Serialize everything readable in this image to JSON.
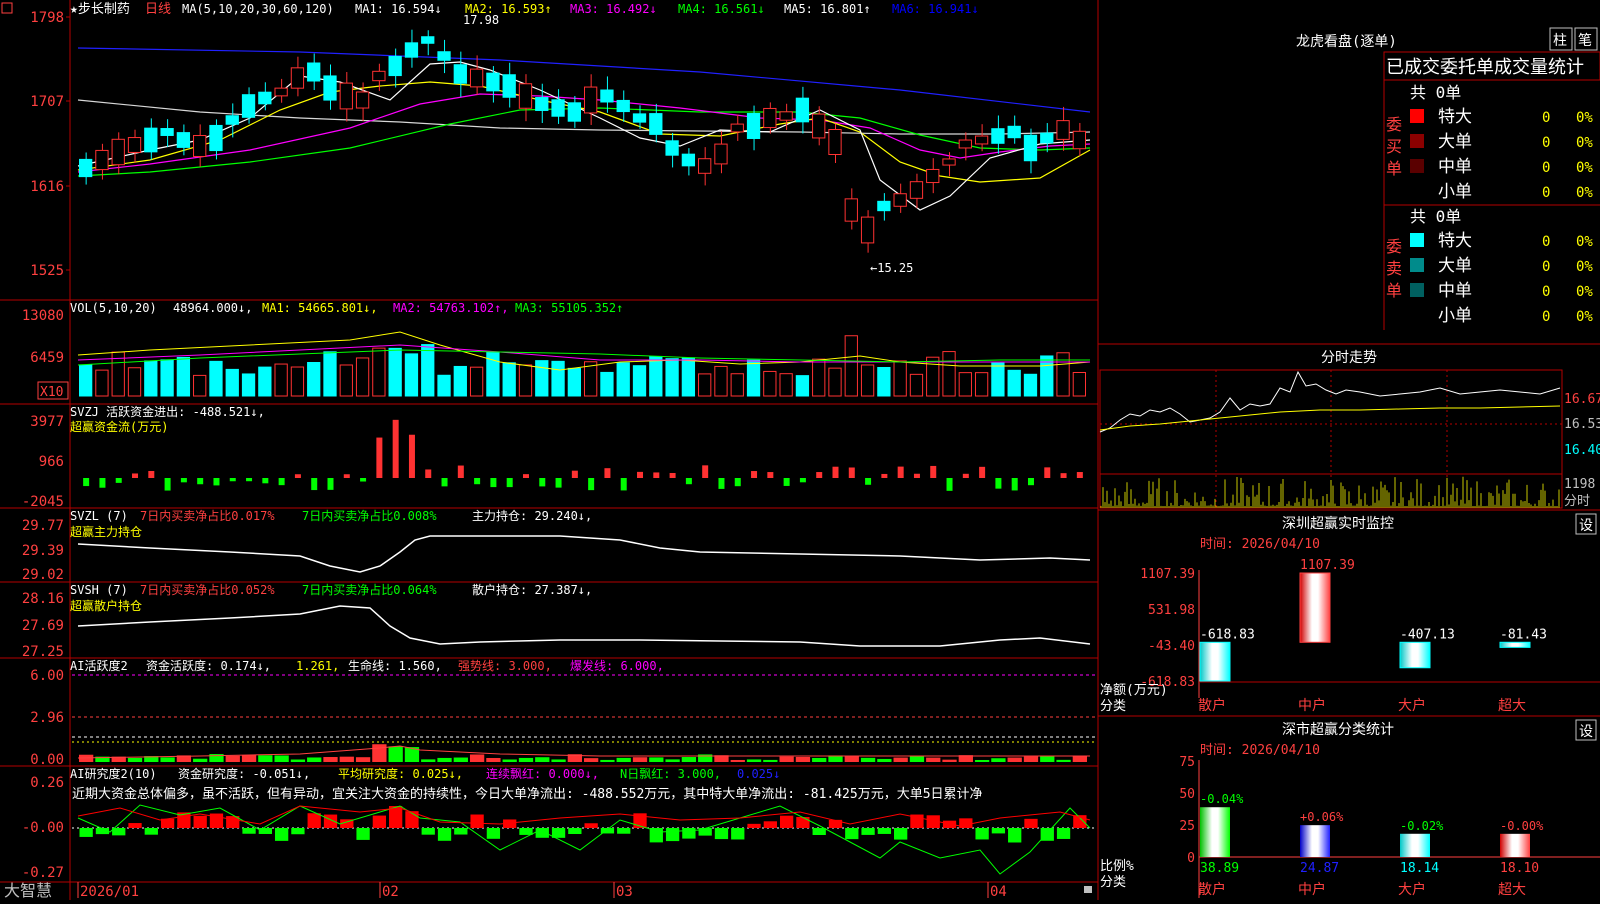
{
  "corner_icon": "menu-icon",
  "colors": {
    "up": "#ff3232",
    "down": "#00ffff",
    "ma1": "#ffffff",
    "ma2": "#ffff00",
    "ma3": "#ff00ff",
    "ma4": "#00ff00",
    "ma5": "#0000ff",
    "ma6": "#d8d8d8",
    "frame": "#b40000",
    "label": "#ff4040"
  },
  "kline": {
    "title": "★步长制药",
    "period": "日线",
    "ma_header": "MA(5,10,20,30,60,120)",
    "ma": [
      "MA1: 16.594↓",
      "MA2: 16.593↑",
      "MA3: 16.492↓",
      "MA4: 16.561↓",
      "MA5: 16.801↑",
      "MA6: 16.941↓"
    ],
    "y_ticks": [
      "1798",
      "1707",
      "1616",
      "1525"
    ],
    "high_label": "17.98",
    "low_label": "←15.25"
  },
  "vol": {
    "header": "VOL(5,10,20)",
    "value": "48964.000↓,",
    "ma": [
      "MA1: 54665.801↓,",
      "MA2: 54763.102↑,",
      "MA3: 55105.352↑"
    ],
    "y_ticks": [
      "13080",
      "6459"
    ],
    "unit": "X10"
  },
  "svzj": {
    "header": "SVZJ  活跃资金进出: -488.521↓,",
    "sub": "超赢资金流(万元)",
    "y_ticks": [
      "3977",
      "966",
      "-2045"
    ]
  },
  "svzl": {
    "header": "SVZL (7)",
    "t1": "7日内买卖净占比0.017%",
    "t2": "7日内买卖净占比0.008%",
    "t3": "主力持仓: 29.240↓,",
    "sub": "超赢主力持仓",
    "y_ticks": [
      "29.77",
      "29.39",
      "29.02"
    ]
  },
  "svsh": {
    "header": "SVSH (7)",
    "t1": "7日内买卖净占比0.052%",
    "t2": "7日内买卖净占比0.064%",
    "t3": "散户持仓: 27.387↓,",
    "sub": "超赢散户持仓",
    "y_ticks": [
      "28.16",
      "27.69",
      "27.25"
    ]
  },
  "ai1": {
    "header": "AI活跃度2",
    "t1": "资金活跃度: 0.174↓,",
    "t2": "1.261,",
    "t3": "生命线: 1.560,",
    "t4": "强势线: 3.000,",
    "t5": "爆发线: 6.000,",
    "y_ticks": [
      "6.00",
      "2.96",
      "0.00"
    ]
  },
  "ai2": {
    "header": "AI研究度2(10)",
    "t1": "资金研究度: -0.051↓,",
    "t2": "平均研究度: 0.025↓,",
    "t3": "连续飘红: 0.000↓,",
    "t4": "N日飘红: 3.000,",
    "t5": "0.025↓",
    "desc": "近期大资金总体偏多，虽不活跃，但有异动，宜关注大资金的持续性，今日大单净流出: -488.552万元，其中特大单净流出: -81.425万元，大单5日累计净",
    "y_ticks": [
      "0.26",
      "-0.00",
      "-0.27"
    ]
  },
  "x_axis": {
    "logo": "大智慧",
    "dates": [
      "2026/01",
      "02",
      "03",
      "04"
    ]
  },
  "lhb": {
    "title": "龙虎看盘(逐单)",
    "btn1": "柱",
    "btn2": "笔",
    "tab": "已成交委托单成交量统计",
    "buy": {
      "label": "委买单",
      "total": "共 0单",
      "rows": [
        {
          "name": "特大",
          "count": "0",
          "pct": "0%",
          "color": "#ff0000"
        },
        {
          "name": "大单",
          "count": "0",
          "pct": "0%",
          "color": "#8b0000"
        },
        {
          "name": "中单",
          "count": "0",
          "pct": "0%",
          "color": "#5a0000"
        },
        {
          "name": "小单",
          "count": "0",
          "pct": "0%",
          "color": "#000000"
        }
      ]
    },
    "sell": {
      "label": "委卖单",
      "total": "共 0单",
      "rows": [
        {
          "name": "特大",
          "count": "0",
          "pct": "0%",
          "color": "#00ffff"
        },
        {
          "name": "大单",
          "count": "0",
          "pct": "0%",
          "color": "#008b8b"
        },
        {
          "name": "中单",
          "count": "0",
          "pct": "0%",
          "color": "#006060"
        },
        {
          "name": "小单",
          "count": "0",
          "pct": "0%",
          "color": "#000000"
        }
      ]
    }
  },
  "intraday": {
    "title": "分时走势",
    "y_ticks": [
      "16.67",
      "16.53",
      "16.40"
    ],
    "vol_label": "1198",
    "vol_unit": "分时"
  },
  "sz_monitor": {
    "title": "深圳超赢实时监控",
    "settings": "设",
    "time": "时间: 2026/04/10",
    "y_ticks": [
      "1107.39",
      "531.98",
      "-43.40",
      "-618.83"
    ],
    "ylabel": "净额(万元)",
    "xlabel": "分类",
    "categories": [
      "散户",
      "中户",
      "大户",
      "超大"
    ],
    "values": [
      -618.83,
      1107.39,
      -407.13,
      -81.43
    ],
    "labels": [
      "-618.83",
      "1107.39",
      "-407.13",
      "-81.43"
    ]
  },
  "sz_class": {
    "title": "深市超赢分类统计",
    "settings": "设",
    "time": "时间: 2026/04/10",
    "y_ticks": [
      "75",
      "50",
      "25",
      "0"
    ],
    "ylabel": "比例%",
    "xlabel": "分类",
    "categories": [
      "散户",
      "中户",
      "大户",
      "超大"
    ],
    "values": [
      38.89,
      24.87,
      18.14,
      18.1
    ],
    "value_labels": [
      "38.89",
      "24.87",
      "18.14",
      "18.10"
    ],
    "delta_labels": [
      "-0.04%",
      "+0.06%",
      "-0.02%",
      "-0.00%"
    ]
  }
}
